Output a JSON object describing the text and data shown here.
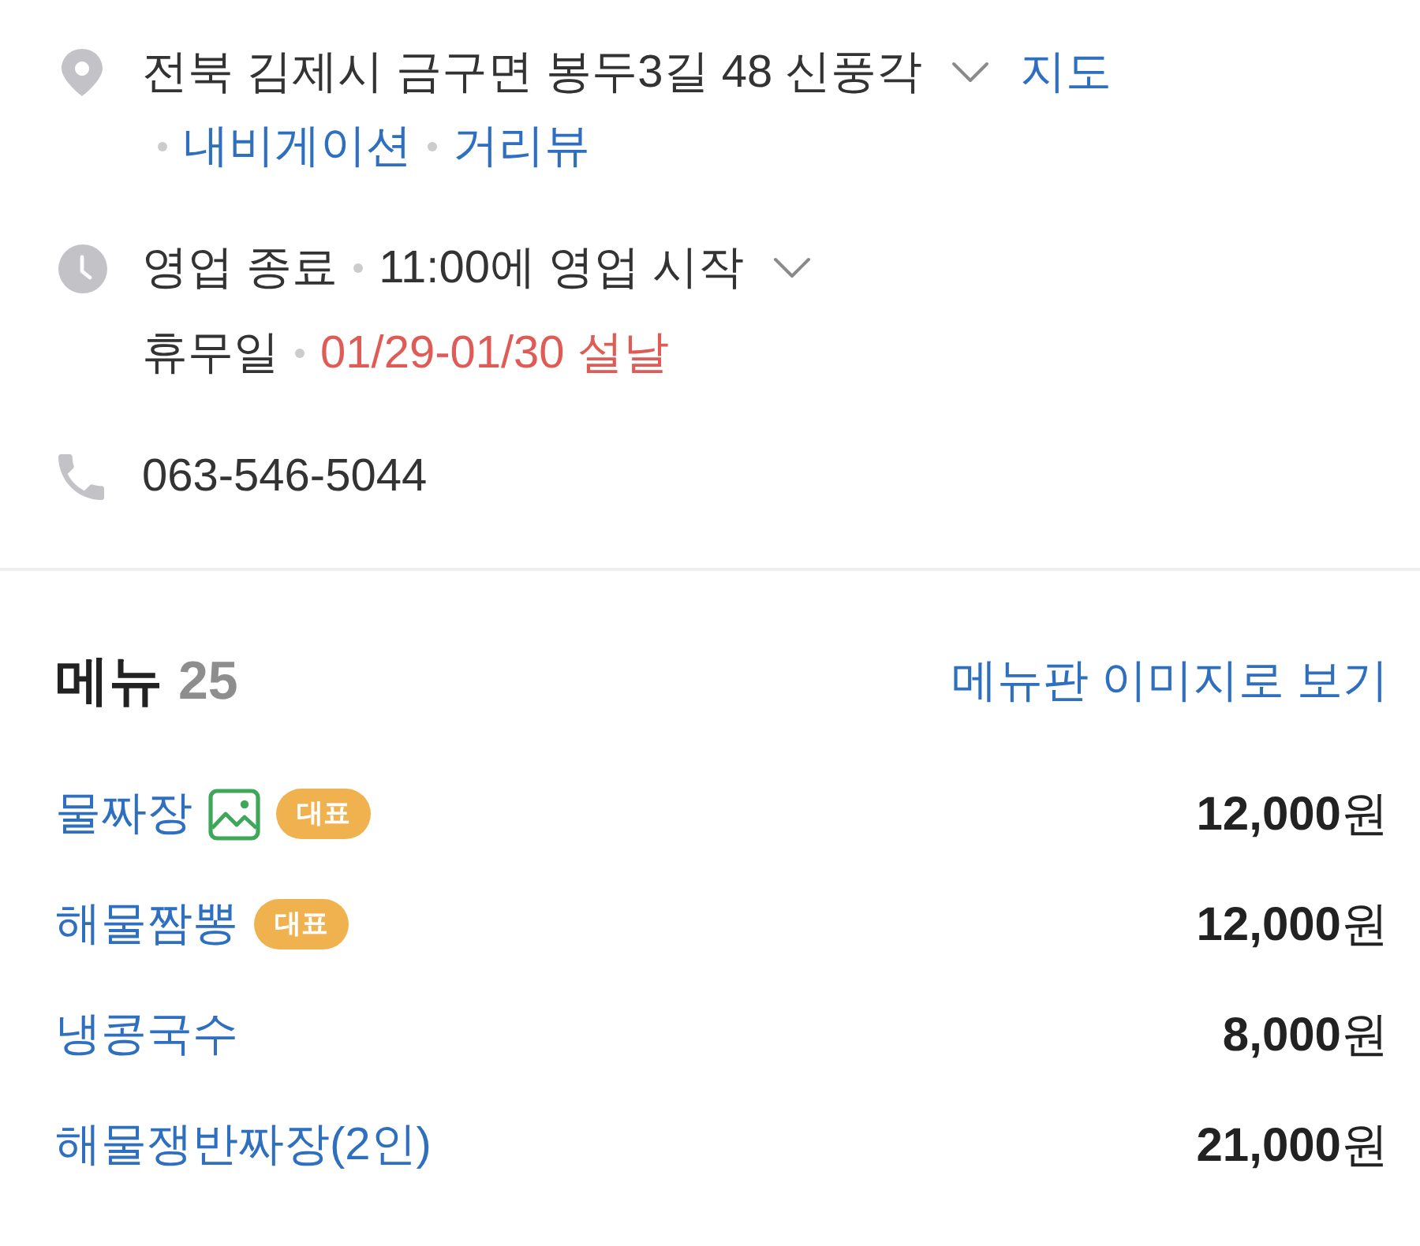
{
  "address": {
    "text": "전북 김제시 금구면 봉두3길 48 신풍각",
    "expanded": false,
    "links": [
      "지도",
      "내비게이션",
      "거리뷰"
    ]
  },
  "hours": {
    "status": "영업 종료",
    "next_open": "11:00에 영업 시작",
    "expanded": false
  },
  "holiday": {
    "label": "휴무일",
    "dates": "01/29-01/30 설날"
  },
  "phone": "063-546-5044",
  "menu": {
    "title": "메뉴",
    "count": "25",
    "image_link": "메뉴판 이미지로 보기",
    "items": [
      {
        "name": "물짜장",
        "has_photo": true,
        "badge": "대표",
        "price": "**12,000**원"
      },
      {
        "name": "해물짬뽕",
        "has_photo": false,
        "badge": "대표",
        "price": "**12,000**원"
      },
      {
        "name": "냉콩국수",
        "has_photo": false,
        "price": "**8,000**원"
      },
      {
        "name": "해물쟁반짜장(2인)",
        "has_photo": false,
        "price": "**21,000**원"
      }
    ]
  }
}
